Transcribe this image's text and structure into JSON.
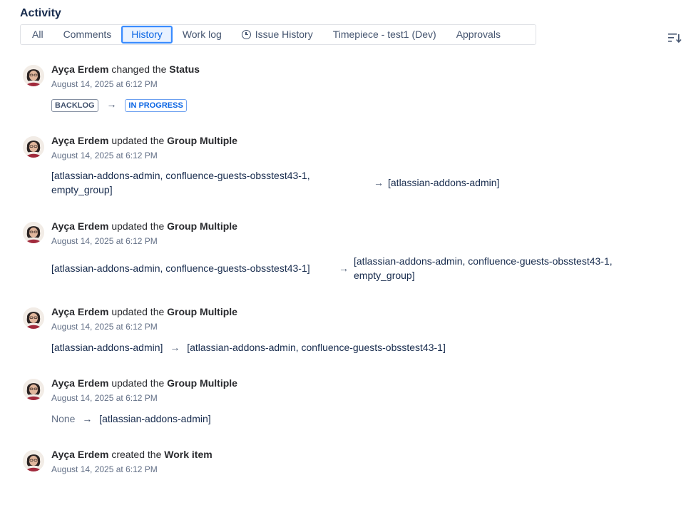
{
  "activity": {
    "title": "Activity",
    "tabs": [
      {
        "label": "All"
      },
      {
        "label": "Comments"
      },
      {
        "label": "History"
      },
      {
        "label": "Work log"
      },
      {
        "label": "Issue History"
      },
      {
        "label": "Timepiece - test1 (Dev)"
      },
      {
        "label": "Approvals"
      }
    ],
    "active_tab": "History"
  },
  "arrow": "→",
  "entries": [
    {
      "user": "Ayça Erdem",
      "verb": "changed the",
      "field": "Status",
      "date": "August 14, 2025 at 6:12 PM",
      "from": "BACKLOG",
      "to": "IN PROGRESS"
    },
    {
      "user": "Ayça Erdem",
      "verb": "updated the",
      "field": "Group Multiple",
      "date": "August 14, 2025 at 6:12 PM",
      "from_line1": "[atlassian-addons-admin, confluence-guests-obsstest43-1,",
      "from_line2": "empty_group]",
      "to": "[atlassian-addons-admin]"
    },
    {
      "user": "Ayça Erdem",
      "verb": "updated the",
      "field": "Group Multiple",
      "date": "August 14, 2025 at 6:12 PM",
      "from": "[atlassian-addons-admin, confluence-guests-obsstest43-1]",
      "to_line1": "[atlassian-addons-admin, confluence-guests-obsstest43-1,",
      "to_line2": "empty_group]"
    },
    {
      "user": "Ayça Erdem",
      "verb": "updated the",
      "field": "Group Multiple",
      "date": "August 14, 2025 at 6:12 PM",
      "from": "[atlassian-addons-admin]",
      "to": "[atlassian-addons-admin, confluence-guests-obsstest43-1]"
    },
    {
      "user": "Ayça Erdem",
      "verb": "updated the",
      "field": "Group Multiple",
      "date": "August 14, 2025 at 6:12 PM",
      "from": "None",
      "to": "[atlassian-addons-admin]"
    },
    {
      "user": "Ayça Erdem",
      "verb": "created the",
      "field": "Work item",
      "date": "August 14, 2025 at 6:12 PM"
    }
  ],
  "icons": {
    "sort": "sort-icon",
    "clock": "clock-icon",
    "avatar": "user-avatar"
  },
  "colors": {
    "accent": "#0c66e4",
    "tab_border": "#dfe1e6",
    "muted": "#626f86"
  }
}
